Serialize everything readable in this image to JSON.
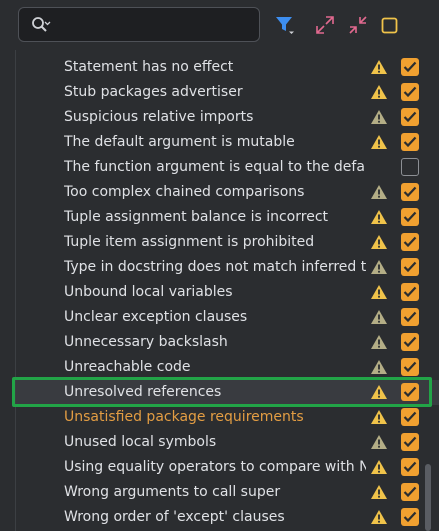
{
  "search": {
    "value": "",
    "placeholder": ""
  },
  "toolbar": {
    "filter_icon": "filter-icon",
    "expand_icon": "expand-all-icon",
    "collapse_icon": "collapse-all-icon",
    "toggle_icon": "toggle-square-icon"
  },
  "colors": {
    "accent_orange": "#f0a030",
    "warning_yellow": "#f0c34a",
    "warning_grey": "#b4ae86",
    "highlight_green": "#22a447",
    "orange_text": "#e39d43"
  },
  "inspections": [
    {
      "label": "Statement has no effect",
      "severity": "warning",
      "checked": true
    },
    {
      "label": "Stub packages advertiser",
      "severity": "warning",
      "checked": true
    },
    {
      "label": "Suspicious relative imports",
      "severity": "weak-warning",
      "checked": true
    },
    {
      "label": "The default argument is mutable",
      "severity": "warning",
      "checked": true
    },
    {
      "label": "The function argument is equal to the default",
      "severity": "none",
      "checked": false
    },
    {
      "label": "Too complex chained comparisons",
      "severity": "weak-warning",
      "checked": true
    },
    {
      "label": "Tuple assignment balance is incorrect",
      "severity": "warning",
      "checked": true
    },
    {
      "label": "Tuple item assignment is prohibited",
      "severity": "warning",
      "checked": true
    },
    {
      "label": "Type in docstring does not match inferred typ",
      "severity": "weak-warning",
      "checked": true
    },
    {
      "label": "Unbound local variables",
      "severity": "warning",
      "checked": true
    },
    {
      "label": "Unclear exception clauses",
      "severity": "weak-warning",
      "checked": true
    },
    {
      "label": "Unnecessary backslash",
      "severity": "weak-warning",
      "checked": true
    },
    {
      "label": "Unreachable code",
      "severity": "weak-warning",
      "checked": true
    },
    {
      "label": "Unresolved references",
      "severity": "warning",
      "checked": true,
      "selected": true
    },
    {
      "label": "Unsatisfied package requirements",
      "severity": "warning",
      "checked": true,
      "orange": true
    },
    {
      "label": "Unused local symbols",
      "severity": "weak-warning",
      "checked": true
    },
    {
      "label": "Using equality operators to compare with Nor",
      "severity": "warning",
      "checked": true
    },
    {
      "label": "Wrong arguments to call super",
      "severity": "warning",
      "checked": true
    },
    {
      "label": "Wrong order of 'except' clauses",
      "severity": "warning",
      "checked": true
    }
  ]
}
